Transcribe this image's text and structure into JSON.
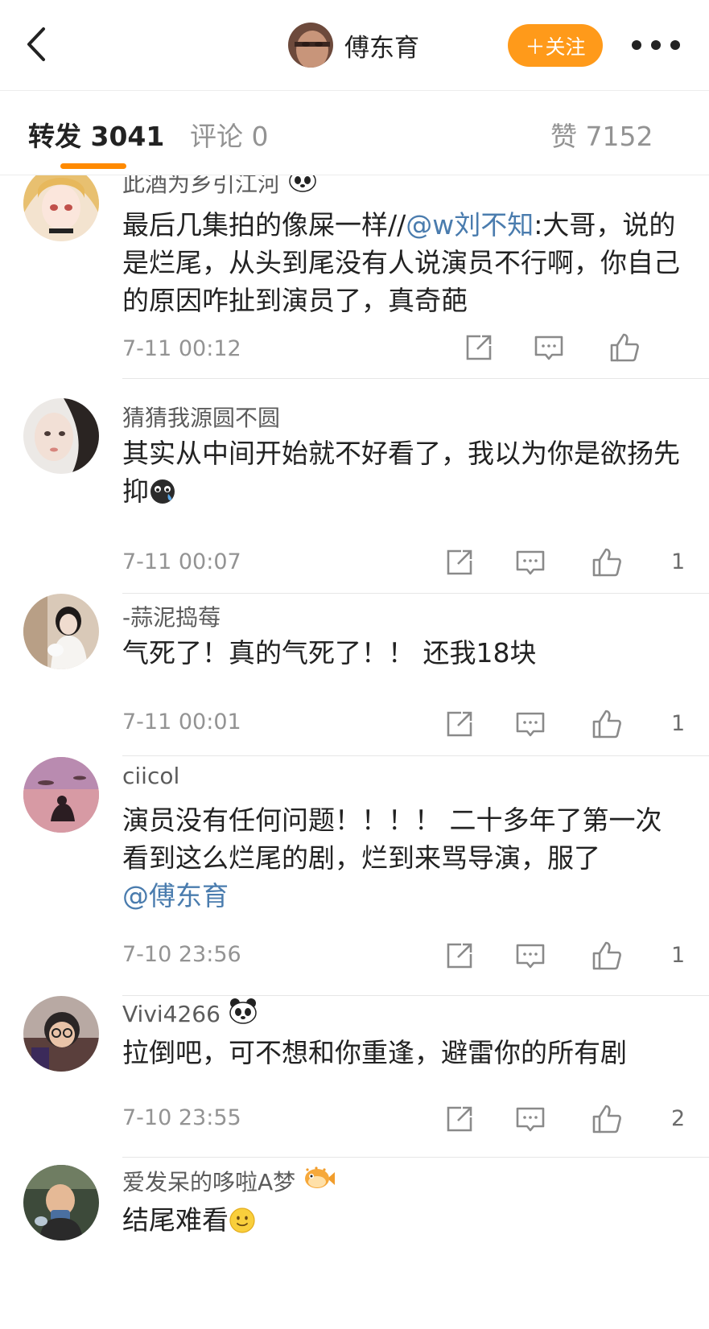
{
  "header": {
    "back_icon": "chevron-left-icon",
    "user_name": "傅东育",
    "follow_label": "＋关注",
    "more_icon": "more-dots-icon",
    "accent": "#ff9a1a"
  },
  "tabs": {
    "repost": {
      "label": "转发",
      "count": "3041"
    },
    "comment": {
      "label": "评论",
      "count": "0"
    },
    "like": {
      "label": "赞",
      "count": "7152"
    }
  },
  "comments": [
    {
      "user": "此酒为乡引江河",
      "badge": "panda-icon",
      "text_before": "最后几集拍的像屎一样//",
      "mention": "@w刘不知",
      "text_after": ":大哥，说的是烂尾，从头到尾没有人说演员不行啊，你自己的原因咋扯到演员了，真奇葩",
      "time": "7-11 00:12",
      "likes": ""
    },
    {
      "user": "猜猜我源圆不圆",
      "text": "其实从中间开始就不好看了，我以为你是欲扬先抑",
      "emoji": "crying-face-emoji",
      "time": "7-11 00:07",
      "likes": "1"
    },
    {
      "user": "-蒜泥捣莓",
      "text": "气死了！真的气死了！！ 还我18块",
      "time": "7-11 00:01",
      "likes": "1"
    },
    {
      "user": "ciicol",
      "text": "演员没有任何问题！！！！ 二十多年了第一次看到这么烂尾的剧，烂到来骂导演，服了",
      "mention": "@傅东育",
      "time": "7-10 23:56",
      "likes": "1"
    },
    {
      "user": "Vivi4266",
      "badge": "panda-icon",
      "text": "拉倒吧，可不想和你重逢，避雷你的所有剧",
      "time": "7-10 23:55",
      "likes": "2"
    },
    {
      "user": "爱发呆的哆啦A梦",
      "badge": "pufferfish-icon",
      "text": "结尾难看",
      "emoji": "smile-face-emoji",
      "time": "",
      "likes": ""
    }
  ],
  "icons": {
    "repost": "share-icon",
    "comment": "comment-icon",
    "like": "thumbs-up-icon"
  }
}
